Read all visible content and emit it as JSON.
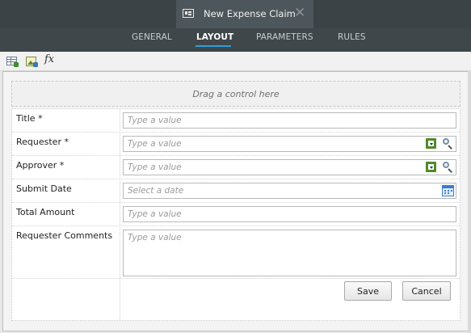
{
  "document_tab": {
    "title": "New Expense Claim",
    "close_glyph": "✕",
    "icon": "form-icon"
  },
  "nav": {
    "tabs": [
      "GENERAL",
      "LAYOUT",
      "PARAMETERS",
      "RULES"
    ],
    "active": "LAYOUT",
    "accent": "#2f9ed8"
  },
  "toolbar": {
    "icons": [
      "table-layout-icon",
      "picture-add-icon",
      "function-icon"
    ],
    "fx_label": "fx"
  },
  "canvas": {
    "drag_hint": "Drag a control here",
    "fields": [
      {
        "label": "Title *",
        "placeholder": "Type a value",
        "type": "text"
      },
      {
        "label": "Requester *",
        "placeholder": "Type a value",
        "type": "people"
      },
      {
        "label": "Approver *",
        "placeholder": "Type a value",
        "type": "people"
      },
      {
        "label": "Submit Date",
        "placeholder": "Select a date",
        "type": "date"
      },
      {
        "label": "Total Amount",
        "placeholder": "Type a value",
        "type": "text"
      },
      {
        "label": "Requester Comments",
        "placeholder": "Type a value",
        "type": "multiline"
      }
    ],
    "buttons": {
      "save": "Save",
      "cancel": "Cancel"
    }
  }
}
